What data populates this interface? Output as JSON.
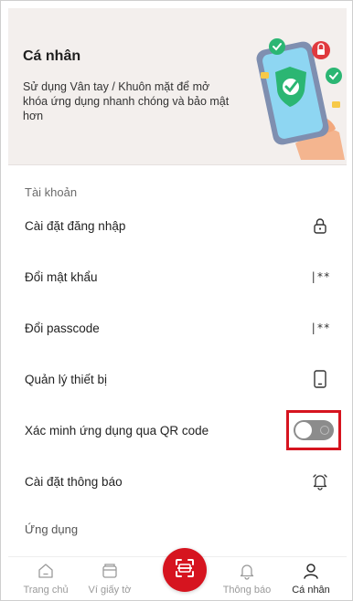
{
  "banner": {
    "title": "Cá nhân",
    "description": "Sử dụng Vân tay / Khuôn mặt để mở khóa ứng dụng nhanh chóng và bảo mật hơn"
  },
  "sections": {
    "account_title": "Tài khoản",
    "app_title": "Ứng dụng"
  },
  "items": [
    {
      "label": "Cài đặt đăng nhập",
      "icon": "lock-icon"
    },
    {
      "label": "Đổi mật khẩu",
      "icon": "password-icon",
      "icon_text": "|**"
    },
    {
      "label": "Đổi passcode",
      "icon": "passcode-icon",
      "icon_text": "|**"
    },
    {
      "label": "Quản lý thiết bị",
      "icon": "phone-icon"
    },
    {
      "label": "Xác minh ứng dụng qua QR code",
      "icon": "toggle-switch",
      "toggle_on": false
    },
    {
      "label": "Cài đặt thông báo",
      "icon": "bell-icon"
    }
  ],
  "nav": {
    "items": [
      {
        "label": "Trang chủ",
        "icon": "home-icon"
      },
      {
        "label": "Ví giấy tờ",
        "icon": "wallet-icon"
      },
      {
        "label": "",
        "icon": "scan-icon"
      },
      {
        "label": "Thông báo",
        "icon": "bell-icon"
      },
      {
        "label": "Cá nhân",
        "icon": "user-icon",
        "active": true
      }
    ]
  },
  "colors": {
    "accent": "#d6141f",
    "banner_bg": "#f3efed",
    "toggle_off": "#8c8c8c"
  }
}
